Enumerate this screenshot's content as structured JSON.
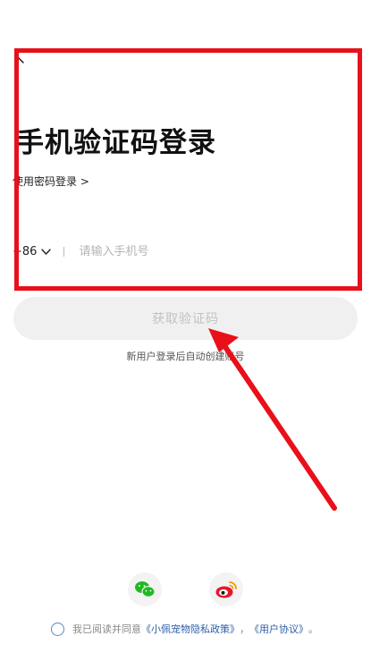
{
  "header": {
    "title": "手机验证码登录",
    "password_login_link": "使用密码登录 >"
  },
  "phone": {
    "country_code": "+86",
    "placeholder": "请输入手机号"
  },
  "actions": {
    "get_code_label": "获取验证码",
    "auto_register_hint": "新用户登录后自动创建账号"
  },
  "social": {
    "icons": [
      "wechat-icon",
      "weibo-icon"
    ]
  },
  "agreement": {
    "prefix": "我已阅读并同意",
    "privacy_link": "《小佩宠物隐私政策》",
    "separator": "，",
    "terms_link": "《用户协议》",
    "suffix": "。"
  },
  "annotation": {
    "highlight_color": "#e8101a",
    "arrow_color": "#e8101a"
  },
  "colors": {
    "link": "#2f5fa8",
    "button_bg": "#f0f0f0",
    "button_text": "#c2c2c2"
  }
}
